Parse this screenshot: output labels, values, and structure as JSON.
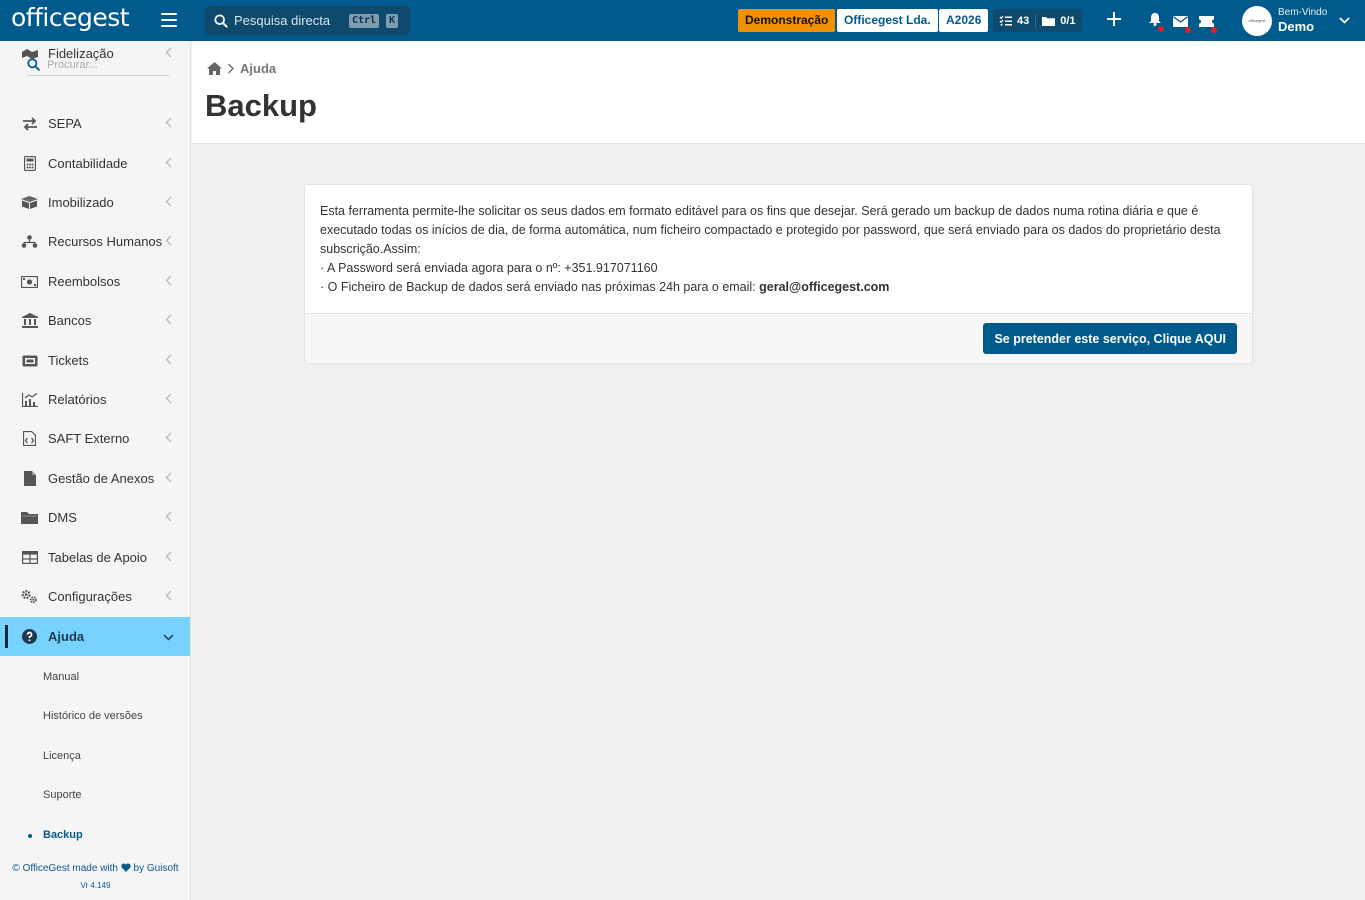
{
  "app": {
    "logo": "officegest",
    "search_placeholder": "Pesquisa directa",
    "shortcut_ctrl": "Ctrl",
    "shortcut_key": "K",
    "demo_badge": "Demonstração",
    "company": "Officegest Lda.",
    "year": "A2026",
    "tasks_count": "43",
    "docs_count": "0/1",
    "welcome": "Bem-Vindo",
    "user_name": "Demo",
    "avatar_text": "officegest"
  },
  "sidebar": {
    "search_placeholder": "Procurar...",
    "items": [
      {
        "label": "Fidelização",
        "icon": "loyalty-icon"
      },
      {
        "label": "SEPA",
        "icon": "transfer-icon"
      },
      {
        "label": "Contabilidade",
        "icon": "calculator-icon"
      },
      {
        "label": "Imobilizado",
        "icon": "box-icon"
      },
      {
        "label": "Recursos Humanos",
        "icon": "people-icon"
      },
      {
        "label": "Reembolsos",
        "icon": "money-icon"
      },
      {
        "label": "Bancos",
        "icon": "bank-icon"
      },
      {
        "label": "Tickets",
        "icon": "ticket-icon"
      },
      {
        "label": "Relatórios",
        "icon": "chart-icon"
      },
      {
        "label": "SAFT Externo",
        "icon": "file-code-icon"
      },
      {
        "label": "Gestão de Anexos",
        "icon": "file-icon"
      },
      {
        "label": "DMS",
        "icon": "folder-icon"
      },
      {
        "label": "Tabelas de Apoio",
        "icon": "table-icon"
      },
      {
        "label": "Configurações",
        "icon": "gears-icon"
      },
      {
        "label": "Ajuda",
        "icon": "help-icon"
      }
    ],
    "submenu": [
      "Manual",
      "Histórico de versões",
      "Licença",
      "Suporte",
      "Backup"
    ],
    "footer_pre": "© OfficeGest made with",
    "footer_post": "by Guisoft",
    "version": "Vr 4.149"
  },
  "breadcrumb": {
    "current": "Ajuda"
  },
  "page": {
    "title": "Backup",
    "description": "Esta ferramenta permite-lhe solicitar os seus dados em formato editável para os fins que desejar. Será gerado um backup de dados numa rotina diária e que é executado todas os inícios de dia, de forma automática, num ficheiro compactado e protegido por password, que será enviado para os dados do proprietário desta subscrição.Assim:",
    "line1": "· A Password será enviada agora para o nº: +351.917071160",
    "line2_prefix": "· O Ficheiro de Backup de dados será enviado nas próximas 24h para o email: ",
    "email": "geral@officegest.com",
    "cta": "Se pretender este serviço, Clique AQUI"
  },
  "colors": {
    "topbar": "#005b8c",
    "accent": "#78d2ff",
    "demo": "#f39200"
  }
}
